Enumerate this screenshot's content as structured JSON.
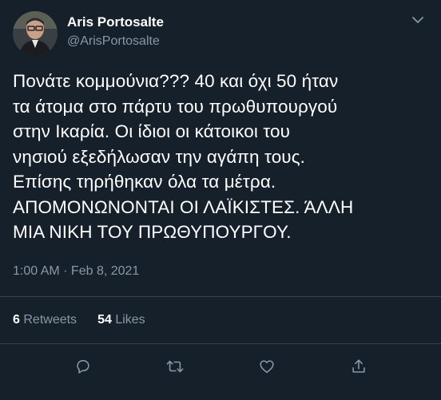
{
  "user": {
    "display_name": "Aris Portosalte",
    "handle": "@ArisPortosalte"
  },
  "tweet": {
    "text": "Πονάτε κομμούνια??? 40 και όχι 50 ήταν\nτα άτομα στο πάρτυ του πρωθυπουργού\nστην Ικαρία. Οι ίδιοι οι κάτοικοι του\nνησιού εξεδήλωσαν την αγάπη τους.\nΕπίσης τηρήθηκαν όλα τα μέτρα.\nΑΠΟΜΟΝΩΝΟΝΤΑΙ ΟΙ ΛΑΪΚΙΣΤΕΣ. ΆΛΛΗ\nΜΙΑ ΝΙΚΗ ΤΟΥ ΠΡΩΘΥΠΟΥΡΓΟΥ.",
    "timestamp": "1:00 AM · Feb 8, 2021"
  },
  "stats": {
    "retweets_count": "6",
    "retweets_label": "Retweets",
    "likes_count": "54",
    "likes_label": "Likes"
  },
  "colors": {
    "background": "#15202b",
    "text": "#ffffff",
    "secondary": "#8899a6",
    "divider": "#38444d"
  },
  "icons": {
    "reply": "reply-icon",
    "retweet": "retweet-icon",
    "like": "heart-icon",
    "share": "share-icon",
    "more": "chevron-down-icon"
  }
}
